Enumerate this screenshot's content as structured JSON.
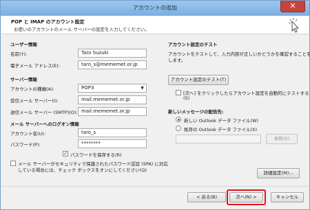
{
  "window": {
    "title": "アカウントの追加",
    "close_glyph": "✕"
  },
  "header": {
    "title": "POP と IMAP のアカウント設定",
    "subtitle": "お使いのアカウントのメール サーバーの設定を入力してください。"
  },
  "user_info": {
    "heading": "ユーザー情報",
    "name_label": "名前(Y):",
    "name_value": "Taro Suzuki",
    "email_label": "電子メール アドレス(E):",
    "email_value": "taro_s@mememet.or.jp"
  },
  "server_info": {
    "heading": "サーバー情報",
    "type_label": "アカウントの種類(A):",
    "type_value": "POP3",
    "incoming_label": "受信メール サーバー(I):",
    "incoming_value": "mail.mememet.or.jp",
    "outgoing_label": "送信メール サーバー (SMTP)(O):",
    "outgoing_value": "mail.mememet.or.jp"
  },
  "login_info": {
    "heading": "メール サーバーへのログオン情報",
    "account_label": "アカウント名(U):",
    "account_value": "taro_s",
    "password_label": "パスワード(P):",
    "password_value": "********",
    "save_password_label": "パスワードを保存する(R)",
    "spa_label_line1": "メール サーバーがセキュリティで保護されたパスワード認証 (SPA) に対応",
    "spa_label_line2": "している場合には、チェック ボックスをオンにしてください(Q)"
  },
  "test": {
    "heading": "アカウント設定のテスト",
    "desc_line1": "アカウントをテストして、入力内容が正しいかどうかを確認することをお勧め",
    "desc_line2": "します。",
    "button_label": "アカウント設定のテスト(T)",
    "auto_test_line1": "[次へ] をクリックしたらアカウント設定を自動的にテストする",
    "auto_test_line2": "(S)"
  },
  "delivery": {
    "heading": "新しいメッセージの配信先:",
    "new_file_label": "新しい Outlook データ ファイル(W)",
    "existing_file_label": "既存の Outlook データ ファイル(X)",
    "existing_path_value": "",
    "browse_label": "参照(S)"
  },
  "more_settings_label": "詳細設定(M)...",
  "footer": {
    "back_label": "< 戻る(B)",
    "next_label": "次へ(N) >",
    "cancel_label": "キャンセル"
  },
  "colors": {
    "highlight": "#e0141b",
    "titlebar": "#7aaee0",
    "close": "#c7433c"
  }
}
